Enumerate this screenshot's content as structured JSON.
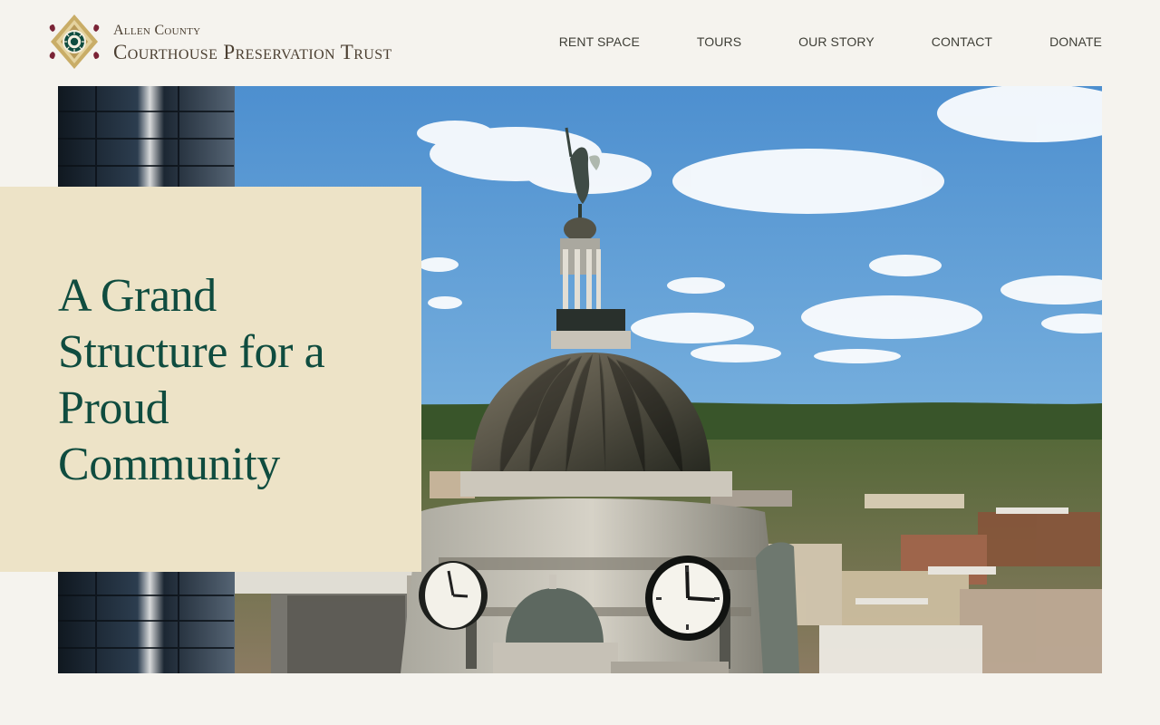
{
  "brand": {
    "name_top": "Allen County",
    "name_bottom": "Courthouse Preservation Trust",
    "logo_icon": "compass-star-logo-icon",
    "colors": {
      "gold": "#b89a58",
      "teal": "#0f4c3f",
      "wine": "#7a2336"
    }
  },
  "nav": {
    "items": [
      {
        "label": "Rent Space"
      },
      {
        "label": "Tours"
      },
      {
        "label": "Our Story"
      },
      {
        "label": "Contact"
      },
      {
        "label": "Donate"
      }
    ]
  },
  "hero": {
    "headline": "A Grand Structure for a Proud Community",
    "image_description": "Aerial view of a courthouse dome with a statue on top, clocks, and city buildings under a blue sky"
  }
}
